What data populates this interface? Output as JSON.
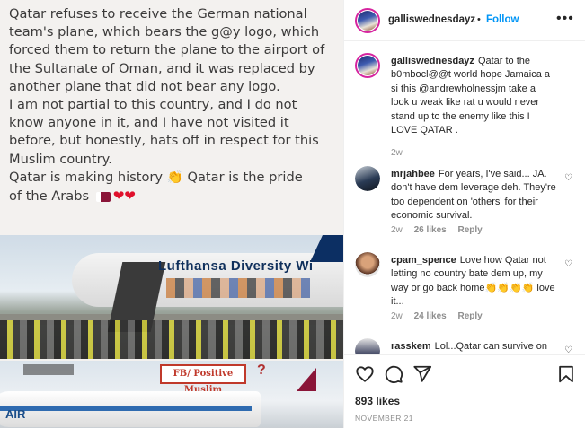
{
  "post_image": {
    "text_lines": [
      "Qatar refuses to receive the German national",
      "team's plane, which bears the g@y logo, which",
      "forced them to return the plane to the airport of",
      "the Sultanate of Oman, and it was replaced by",
      "another plane that did not bear any logo.",
      " I am not partial to this country, and I do not",
      "know anyone in it, and I have not visited it",
      "before, but honestly, hats off in respect for this",
      "Muslim country.",
      " Qatar is making history",
      "Qatar is the pride",
      "of the Arabs"
    ],
    "photo1_livery": "Lufthansa  Diversity Wi",
    "photo2_banner": "FB/ Positive Muslim",
    "photo2_question": "?",
    "photo2_tag": "AIR"
  },
  "header": {
    "username": "galliswednesdayz",
    "dot": "•",
    "follow_label": "Follow",
    "more_label": "•••"
  },
  "caption": {
    "username": "galliswednesdayz",
    "text": "Qatar to the b0mbocl@@t world hope Jamaica a si this @andrewholnessjm take a look u weak like rat u would never stand up to the enemy like this I LOVE QATAR .",
    "time": "2w"
  },
  "comments": [
    {
      "username": "mrjahbee",
      "text": "For years, I've said... JA. don't have dem leverage deh. They're too dependent on 'others' for their economic survival.",
      "time": "2w",
      "likes": "26 likes",
      "reply": "Reply"
    },
    {
      "username": "cpam_spence",
      "text": "Love how Qatar not letting no country bate dem up, my way or go back home👏👏👏👏 love it...",
      "time": "2w",
      "likes": "24 likes",
      "reply": "Reply"
    },
    {
      "username": "rasskem",
      "text": "Lol...Qatar can survive on",
      "time": "",
      "likes": "",
      "reply": ""
    }
  ],
  "footer": {
    "likes": "893 likes",
    "date": "NOVEMBER 21"
  },
  "colors": {
    "accent": "#0095f6",
    "muted": "#8e8e8e",
    "text": "#262626",
    "border": "#efefef"
  },
  "icons": [
    "heart-icon",
    "comment-icon",
    "share-icon",
    "bookmark-icon",
    "more-icon"
  ]
}
